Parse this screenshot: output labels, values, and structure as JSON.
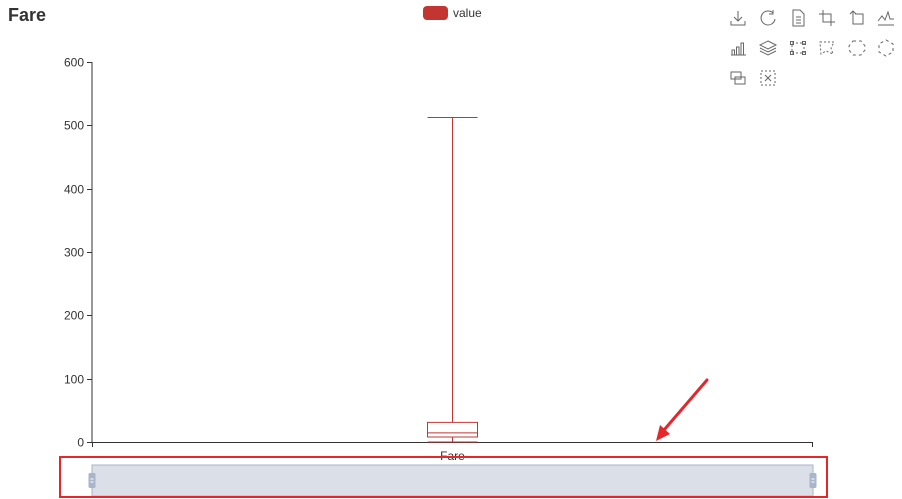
{
  "colors": {
    "series": "#c23531",
    "axis": "#333333",
    "zoom_fill": "#dadfe8",
    "zoom_border": "#a9b6ca",
    "annotation": "#e5262a",
    "icon": "#666666"
  },
  "toolbox": {
    "tools": [
      {
        "name": "save-as-image-icon"
      },
      {
        "name": "restore-icon"
      },
      {
        "name": "data-view-icon"
      },
      {
        "name": "data-zoom-icon"
      },
      {
        "name": "data-zoom-back-icon"
      },
      {
        "name": "line-chart-icon"
      },
      {
        "name": "bar-chart-icon"
      },
      {
        "name": "stack-icon"
      },
      {
        "name": "rect-select-icon"
      },
      {
        "name": "polygon-select-icon"
      },
      {
        "name": "keep-selection-icon"
      },
      {
        "name": "clear-selection-icon"
      },
      {
        "name": "tiled-icon"
      },
      {
        "name": "clear-icon"
      }
    ]
  },
  "chart_data": {
    "type": "boxplot",
    "title": "Fare",
    "legend": [
      "value"
    ],
    "legend_position": "top-center",
    "categories": [
      "Fare"
    ],
    "series": [
      {
        "name": "value",
        "color": "#c23531",
        "boxes": [
          {
            "category": "Fare",
            "min": 0,
            "q1": 7.9,
            "median": 14.45,
            "q3": 31,
            "max": 512.33
          }
        ]
      }
    ],
    "ylim": [
      0,
      600
    ],
    "yticks": [
      0,
      100,
      200,
      300,
      400,
      500,
      600
    ],
    "grid": false,
    "data_zoom": {
      "type": "slider",
      "start_percent": 0,
      "end_percent": 100,
      "highlighted": true
    }
  }
}
